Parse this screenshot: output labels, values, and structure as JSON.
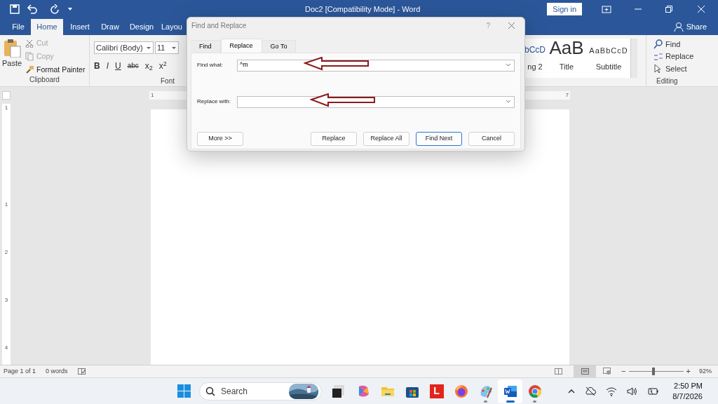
{
  "window": {
    "title": "Doc2 [Compatibility Mode]  -  Word",
    "sign_in": "Sign in"
  },
  "ribbon_tabs": [
    {
      "label": "File",
      "selected": false
    },
    {
      "label": "Home",
      "selected": true
    },
    {
      "label": "Insert",
      "selected": false
    },
    {
      "label": "Draw",
      "selected": false
    },
    {
      "label": "Design",
      "selected": false
    },
    {
      "label": "Layou",
      "selected": false
    }
  ],
  "share": "Share",
  "clipboard": {
    "paste": "Paste",
    "label": "Clipboard",
    "items": [
      {
        "label": "Cut",
        "disabled": true
      },
      {
        "label": "Copy",
        "disabled": true
      },
      {
        "label": "Format Painter",
        "disabled": false
      }
    ]
  },
  "font": {
    "name": "Calibri (Body)",
    "size": "11",
    "label": "Font",
    "buttons": [
      "B",
      "I",
      "U",
      "abc",
      "x$_{2}$",
      "x$^{2}$"
    ]
  },
  "styles": [
    {
      "sample": "bCcD",
      "name": "ng 2"
    },
    {
      "sample": "AaB",
      "name": "Title"
    },
    {
      "sample": "AaBbCcD",
      "name": "Subtitle"
    }
  ],
  "editing": {
    "label": "Editing",
    "items": [
      "Find",
      "Replace",
      "Select"
    ]
  },
  "ruler": {
    "horizontal": [
      "1",
      "7"
    ],
    "vertical": [
      "1",
      "1",
      "2",
      "3",
      "4"
    ]
  },
  "dialog": {
    "title": "Find and Replace",
    "help": "?",
    "tabs": [
      {
        "label": "Find",
        "selected": false
      },
      {
        "label": "Replace",
        "selected": true
      },
      {
        "label": "Go To",
        "selected": false
      }
    ],
    "fields": [
      {
        "label": "Find what:",
        "value": "^m",
        "annotated": true
      },
      {
        "label": "Replace with:",
        "annotated": true
      }
    ],
    "buttons": [
      {
        "label": "More >>",
        "default": false
      },
      {
        "label": "Replace",
        "default": false
      },
      {
        "label": "Replace All",
        "default": false
      },
      {
        "label": "Find Next",
        "default": true
      },
      {
        "label": "Cancel",
        "default": false
      }
    ]
  },
  "status_bar": {
    "page": "Page 1 of 1",
    "words": "0 words",
    "zoom": {
      "minus": "−",
      "plus": "+",
      "level": 0.45,
      "reading": "92%"
    }
  },
  "taskbar": {
    "search": {
      "placeholder": "Search"
    },
    "apps": [
      {
        "kind": "taskview",
        "open": false,
        "selected": false
      },
      {
        "kind": "copilot",
        "open": false,
        "selected": false
      },
      {
        "kind": "explorer",
        "open": false,
        "selected": false
      },
      {
        "kind": "store",
        "open": false,
        "selected": false
      },
      {
        "kind": "letter",
        "label": "L",
        "open": false,
        "selected": false
      },
      {
        "kind": "firefox",
        "open": false,
        "selected": false
      },
      {
        "kind": "paint",
        "open": true,
        "selected": false
      },
      {
        "kind": "word",
        "open": true,
        "selected": true
      },
      {
        "kind": "chrome",
        "open": true,
        "selected": false
      }
    ],
    "clock": {
      "time": "2:50 PM",
      "date": "8/7/2026"
    }
  }
}
